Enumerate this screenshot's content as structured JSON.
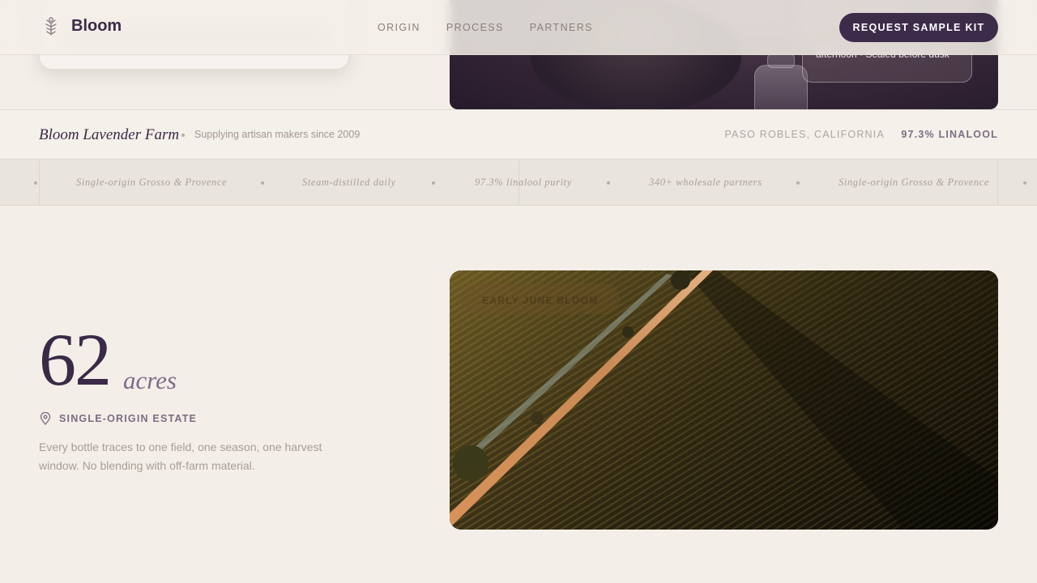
{
  "nav": {
    "logo_text": "Bloom",
    "links": [
      "ORIGIN",
      "PROCESS",
      "PARTNERS"
    ],
    "cta_label": "REQUEST SAMPLE KIT"
  },
  "hero": {
    "badge_text": "afternoon · Sealed before dusk"
  },
  "brand_bar": {
    "name": "Bloom Lavender Farm",
    "since": "Supplying artisan makers since 2009",
    "location": "PASO ROBLES, CALIFORNIA",
    "linalool": "97.3% LINALOOL"
  },
  "marquee": {
    "items": [
      "Single-origin Grosso & Provence",
      "Steam-distilled daily",
      "97.3% linalool purity",
      "340+ wholesale partners",
      "Single-origin Grosso & Provence"
    ]
  },
  "stat": {
    "value": "62",
    "unit": "acres",
    "label": "SINGLE-ORIGIN ESTATE",
    "description": "Every bottle traces to one field, one season, one harvest window. No blending with off-farm material."
  },
  "field_photo": {
    "badge_text": "EARLY JUNE BLOOM"
  },
  "colors": {
    "background": "#f3efe8",
    "primary": "#3d2b4a",
    "accent": "#7e6a8a",
    "muted_text": "#a79c96"
  },
  "icons": {
    "logo": "lavender-sprig-icon",
    "estate": "map-pin-icon"
  }
}
